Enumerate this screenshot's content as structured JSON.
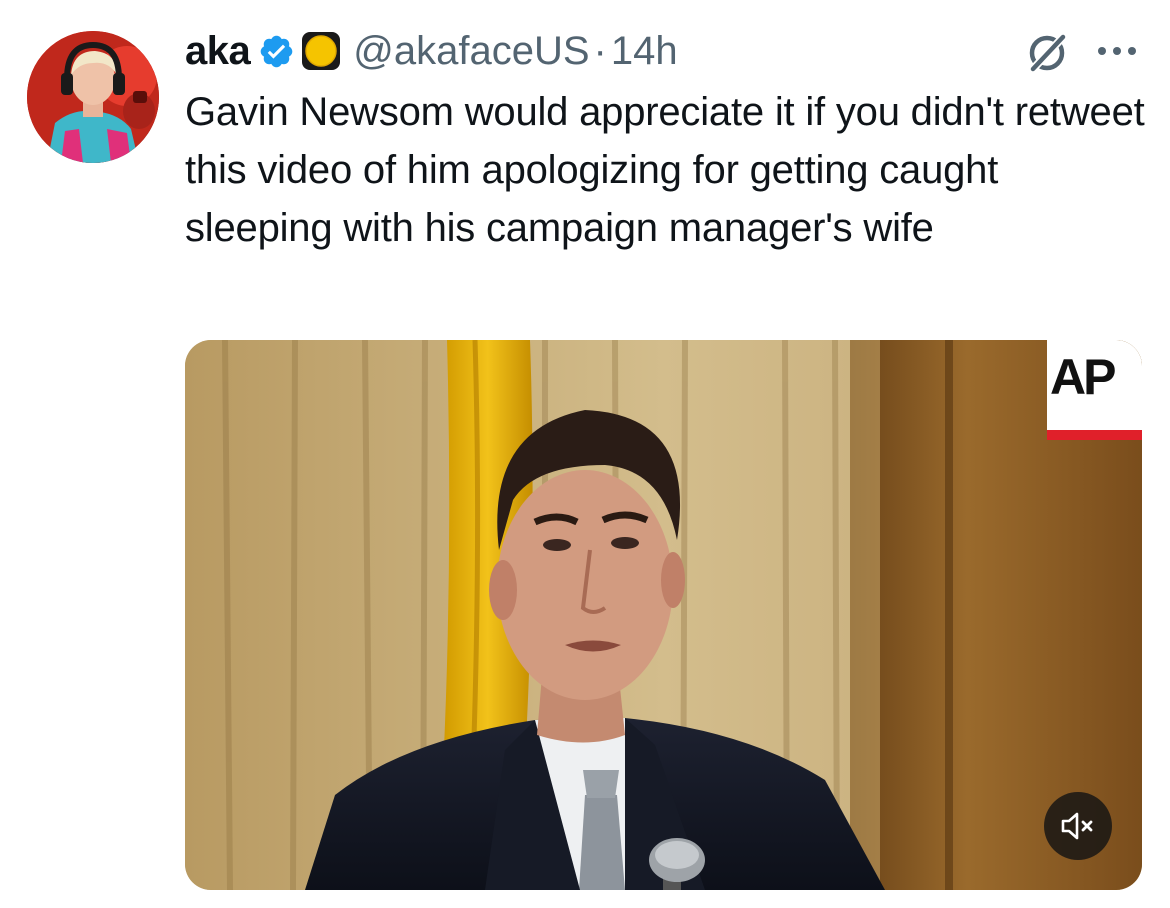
{
  "author": {
    "display_name": "aka",
    "handle": "@akafaceUS",
    "separator": "·",
    "time": "14h",
    "verified_color": "#1d9bf0",
    "badge_emoji": "yellow-circle"
  },
  "tweet": {
    "text": "Gavin Newsom would appreciate it if you didn't retweet this video of him apologizing for getting caught sleeping with his campaign manager's wife"
  },
  "media": {
    "type": "video",
    "watermark_text": "AP",
    "watermark_accent": "#e0202a",
    "muted": true
  },
  "actions": {
    "grok_icon": "grok-icon",
    "more_icon": "more-icon",
    "mute_icon": "speaker-muted-icon"
  }
}
